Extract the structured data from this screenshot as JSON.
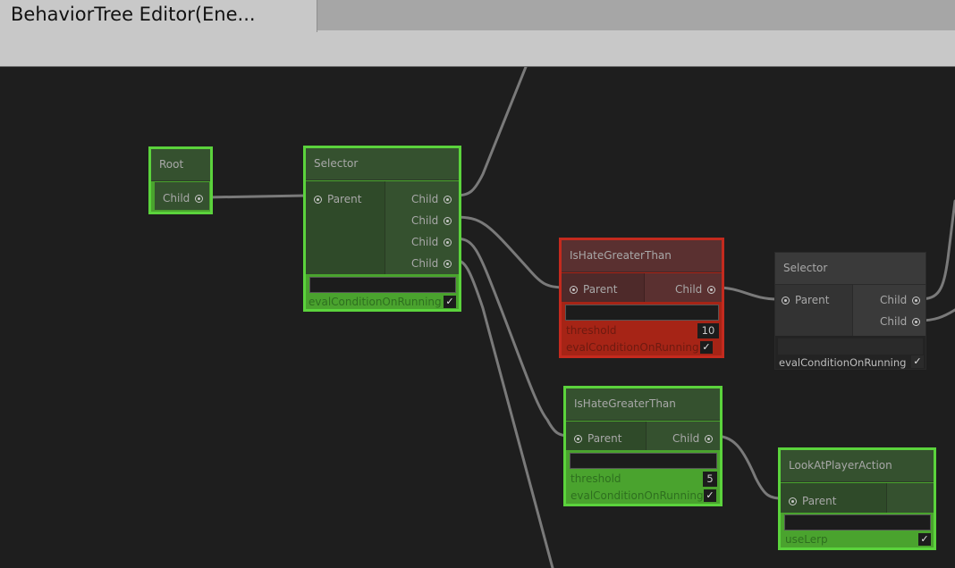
{
  "window": {
    "tab_title": "BehaviorTree Editor(Ene..."
  },
  "labels": {
    "parent": "Parent",
    "child": "Child",
    "eval": "evalConditionOnRunning",
    "threshold": "threshold",
    "useLerp": "useLerp",
    "check": "✓"
  },
  "nodes": {
    "root": {
      "title": "Root"
    },
    "selector1": {
      "title": "Selector"
    },
    "hate_red": {
      "title": "IsHateGreaterThan",
      "threshold": "10"
    },
    "selector2": {
      "title": "Selector"
    },
    "hate_green": {
      "title": "IsHateGreaterThan",
      "threshold": "5"
    },
    "look": {
      "title": "LookAtPlayerAction"
    }
  },
  "colors": {
    "success": "#5bd33c",
    "failure": "#c42a1e",
    "idle": "#3a3a3a",
    "wire": "#7a7a7a",
    "canvas": "#1e1e1e"
  }
}
